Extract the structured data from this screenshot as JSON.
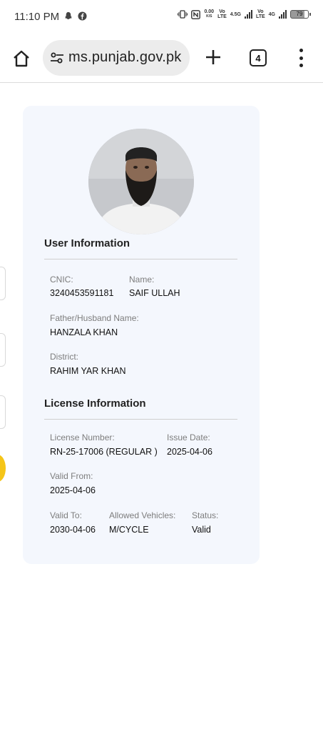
{
  "status_bar": {
    "time": "11:10 PM",
    "left_icons": [
      "snapchat-icon",
      "facebook-icon"
    ],
    "speed_value": "0.00",
    "speed_unit": "K/S",
    "sim1_label_top": "Vo",
    "sim1_label_bottom": "LTE",
    "network1": "4.5G",
    "sim2_label_top": "Vo",
    "sim2_label_bottom": "LTE",
    "network2": "4G",
    "battery": "79"
  },
  "browser": {
    "url": "ms.punjab.gov.pk",
    "tab_count": "4"
  },
  "user_info": {
    "section_title": "User Information",
    "cnic_label": "CNIC:",
    "cnic_value": "3240453591181",
    "name_label": "Name:",
    "name_value": "SAIF ULLAH",
    "father_label": "Father/Husband Name:",
    "father_value": "HANZALA KHAN",
    "district_label": "District:",
    "district_value": "RAHIM YAR KHAN"
  },
  "license_info": {
    "section_title": "License Information",
    "number_label": "License Number:",
    "number_value": "RN-25-17006 (REGULAR )",
    "issue_label": "Issue Date:",
    "issue_value": "2025-04-06",
    "valid_from_label": "Valid From:",
    "valid_from_value": "2025-04-06",
    "valid_to_label": "Valid To:",
    "valid_to_value": "2030-04-06",
    "vehicles_label": "Allowed Vehicles:",
    "vehicles_value": "M/CYCLE",
    "status_label": "Status:",
    "status_value": "Valid"
  },
  "colors": {
    "card_background": "#f4f7fd",
    "edge_accent": "#f5c518"
  }
}
